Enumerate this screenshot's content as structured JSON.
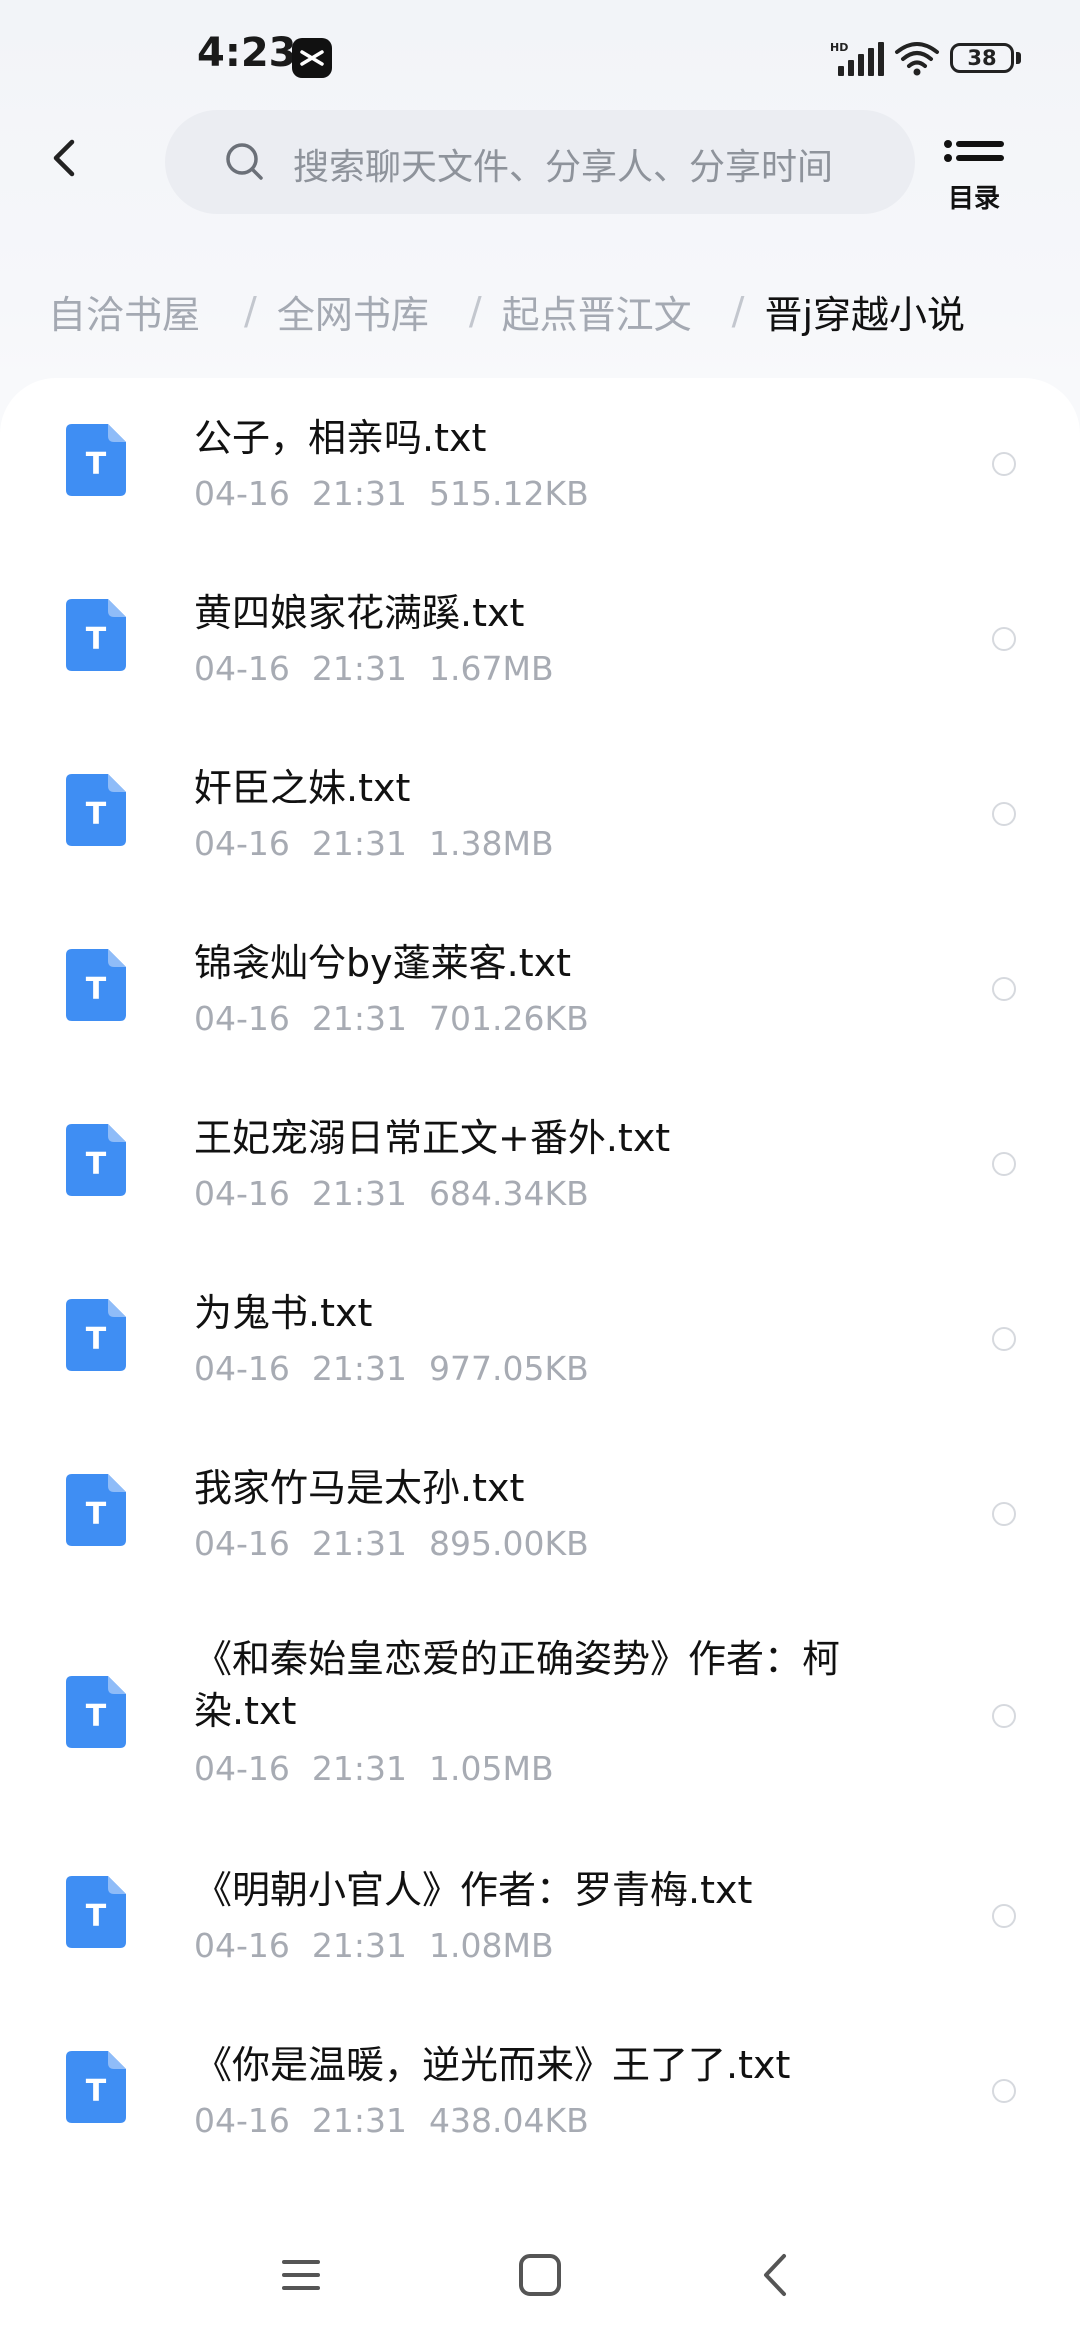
{
  "status_bar": {
    "time": "4:23",
    "battery": "38",
    "icons": [
      "capcut-icon",
      "signal-hd-icon",
      "wifi-icon",
      "battery-icon"
    ]
  },
  "header": {
    "back_icon": "chevron-left-icon",
    "search_placeholder": "搜索聊天文件、分享人、分享时间",
    "toc_label": "目录"
  },
  "breadcrumb": [
    "自洽书屋",
    "全网书库",
    "起点晋江文",
    "晋j穿越小说"
  ],
  "files": [
    {
      "name": "公子，相亲吗.txt",
      "date": "04-16",
      "time": "21:31",
      "size": "515.12KB"
    },
    {
      "name": "黄四娘家花满蹊.txt",
      "date": "04-16",
      "time": "21:31",
      "size": "1.67MB"
    },
    {
      "name": "奸臣之妹.txt",
      "date": "04-16",
      "time": "21:31",
      "size": "1.38MB"
    },
    {
      "name": "锦衾灿兮by蓬莱客.txt",
      "date": "04-16",
      "time": "21:31",
      "size": "701.26KB"
    },
    {
      "name": "王妃宠溺日常正文+番外.txt",
      "date": "04-16",
      "time": "21:31",
      "size": "684.34KB"
    },
    {
      "name": "为鬼书.txt",
      "date": "04-16",
      "time": "21:31",
      "size": "977.05KB"
    },
    {
      "name": "我家竹马是太孙.txt",
      "date": "04-16",
      "time": "21:31",
      "size": "895.00KB"
    },
    {
      "name": "《和秦始皇恋爱的正确姿势》作者：柯染.txt",
      "date": "04-16",
      "time": "21:31",
      "size": "1.05MB"
    },
    {
      "name": "《明朝小官人》作者：罗青梅.txt",
      "date": "04-16",
      "time": "21:31",
      "size": "1.08MB"
    },
    {
      "name": "《你是温暖，逆光而来》王了了.txt",
      "date": "04-16",
      "time": "21:31",
      "size": "438.04KB"
    }
  ],
  "file_icon_letter": "T",
  "colors": {
    "file_icon": "#3f8ef3",
    "meta_text": "#a7abb3",
    "breadcrumb_inactive": "#a4a9b2"
  },
  "nav_bar": [
    "menu-icon",
    "home-icon",
    "back-icon"
  ]
}
